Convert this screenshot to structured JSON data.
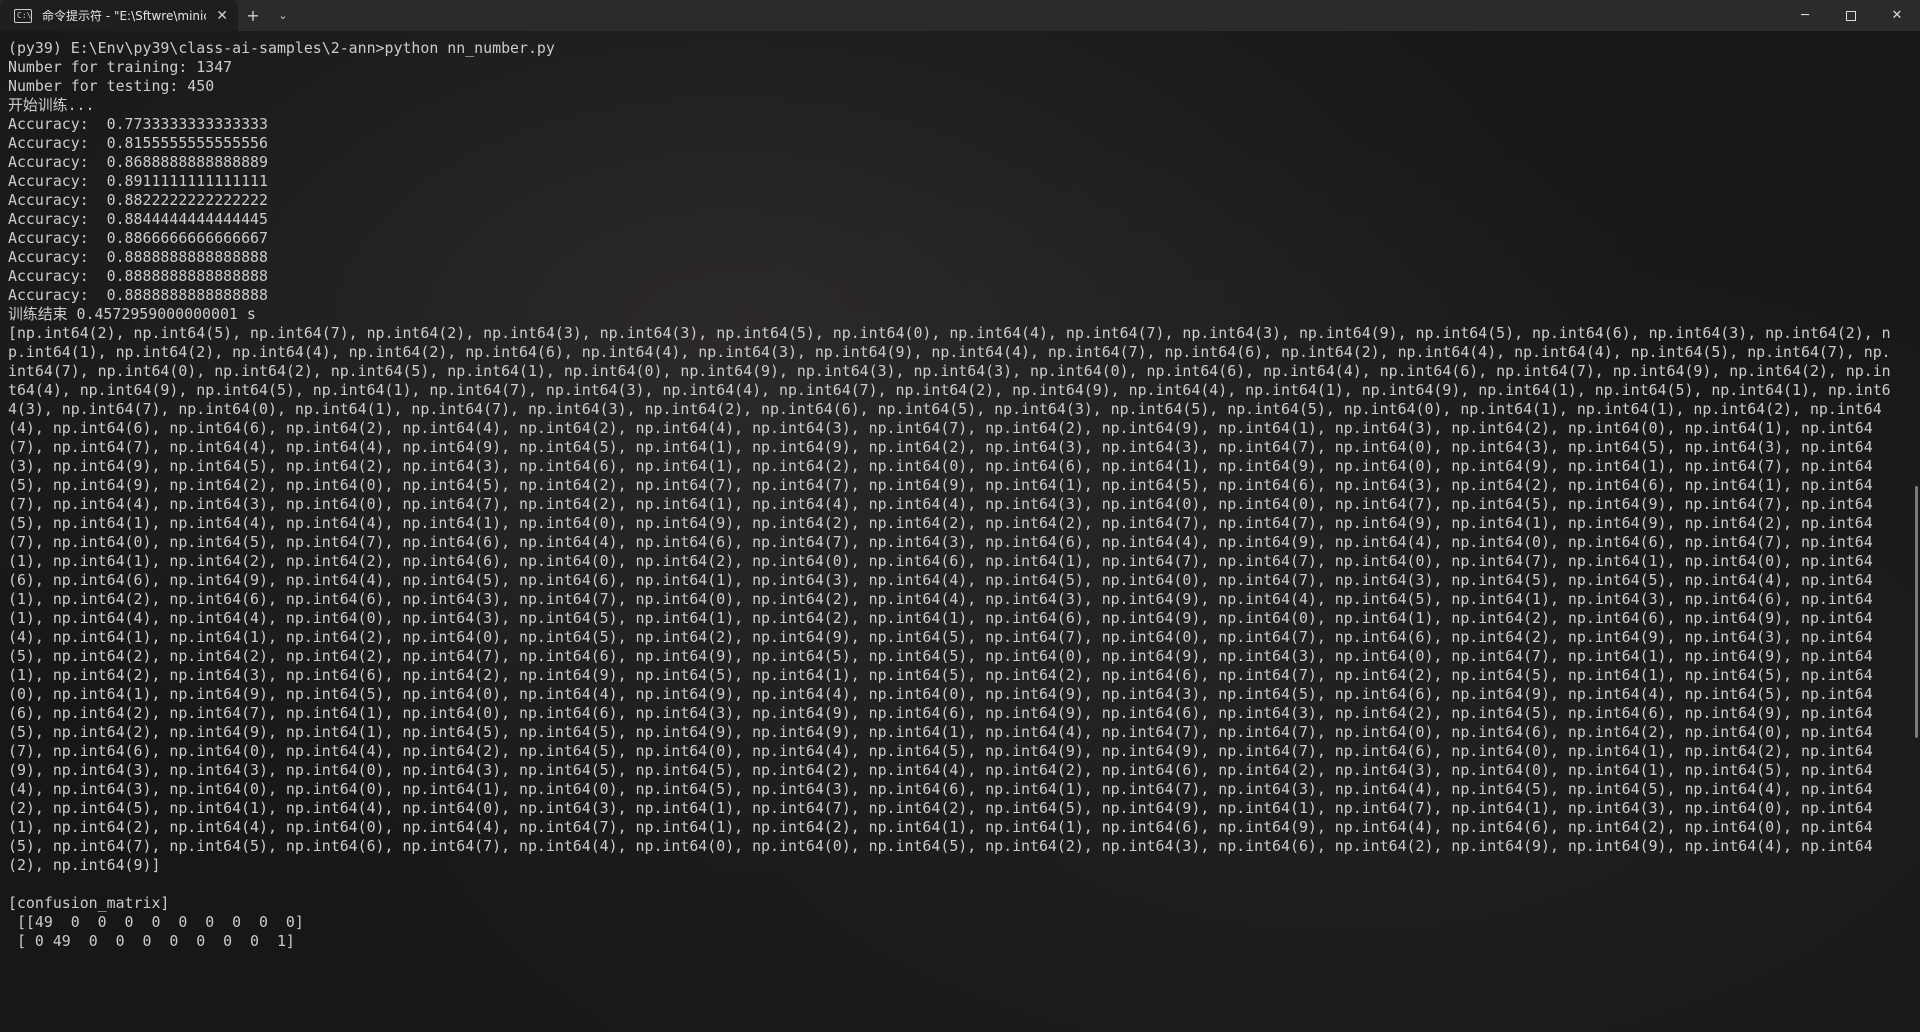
{
  "tab": {
    "icon_text": "C:\\",
    "title": "命令提示符 - \"E:\\Sftwre\\minic"
  },
  "titlebar": {
    "close_tab": "✕",
    "new_tab": "+",
    "dropdown": "⌄",
    "minimize": "─",
    "close": "✕"
  },
  "terminal": {
    "lines": [
      "(py39) E:\\Env\\py39\\class-ai-samples\\2-ann>python nn_number.py",
      "Number for training: 1347",
      "Number for testing: 450",
      "开始训练...",
      "Accuracy:  0.7733333333333333",
      "Accuracy:  0.8155555555555556",
      "Accuracy:  0.8688888888888889",
      "Accuracy:  0.8911111111111111",
      "Accuracy:  0.8822222222222222",
      "Accuracy:  0.8844444444444445",
      "Accuracy:  0.8866666666666667",
      "Accuracy:  0.8888888888888888",
      "Accuracy:  0.8888888888888888",
      "Accuracy:  0.8888888888888888",
      "训练结束 0.4572959000000001 s",
      "[np.int64(2), np.int64(5), np.int64(7), np.int64(2), np.int64(3), np.int64(3), np.int64(5), np.int64(0), np.int64(4), np.int64(7), np.int64(3), np.int64(9), np.int64(5), np.int64(6), np.int64(3), np.int64(2), np.int64(1), np.int64(2), np.int64(4), np.int64(2), np.int64(6), np.int64(4), np.int64(3), np.int64(9), np.int64(4), np.int64(7), np.int64(6), np.int64(2), np.int64(4), np.int64(4), np.int64(5), np.int64(7), np.int64(7), np.int64(0), np.int64(2), np.int64(5), np.int64(1), np.int64(0), np.int64(9), np.int64(3), np.int64(3), np.int64(0), np.int64(6), np.int64(4), np.int64(6), np.int64(7), np.int64(9), np.int64(2), np.int64(4), np.int64(9), np.int64(5), np.int64(1), np.int64(7), np.int64(3), np.int64(4), np.int64(7), np.int64(2), np.int64(9), np.int64(4), np.int64(1), np.int64(9), np.int64(1), np.int64(5), np.int64(1), np.int64(3), np.int64(7), np.int64(0), np.int64(1), np.int64(7), np.int64(3), np.int64(2), np.int64(6), np.int64(5), np.int64(3), np.int64(5), np.int64(5), np.int64(0), np.int64(1), np.int64(1), np.int64(2), np.int64(4), np.int64(6), np.int64(6), np.int64(2), np.int64(4), np.int64(2), np.int64(4), np.int64(3), np.int64(7), np.int64(2), np.int64(9), np.int64(1), np.int64(3), np.int64(2), np.int64(0), np.int64(1), np.int64(7), np.int64(7), np.int64(4), np.int64(4), np.int64(9), np.int64(5), np.int64(1), np.int64(9), np.int64(2), np.int64(3), np.int64(3), np.int64(7), np.int64(0), np.int64(3), np.int64(5), np.int64(3), np.int64(3), np.int64(9), np.int64(5), np.int64(2), np.int64(3), np.int64(6), np.int64(1), np.int64(2), np.int64(0), np.int64(6), np.int64(1), np.int64(9), np.int64(0), np.int64(9), np.int64(1), np.int64(7), np.int64(5), np.int64(9), np.int64(2), np.int64(0), np.int64(5), np.int64(2), np.int64(7), np.int64(7), np.int64(9), np.int64(1), np.int64(5), np.int64(6), np.int64(3), np.int64(2), np.int64(6), np.int64(1), np.int64(7), np.int64(4), np.int64(3), np.int64(0), np.int64(7), np.int64(2), np.int64(1), np.int64(4), np.int64(4), np.int64(3), np.int64(0), np.int64(0), np.int64(7), np.int64(5), np.int64(9), np.int64(7), np.int64(5), np.int64(1), np.int64(4), np.int64(4), np.int64(1), np.int64(0), np.int64(9), np.int64(2), np.int64(2), np.int64(2), np.int64(7), np.int64(7), np.int64(9), np.int64(1), np.int64(9), np.int64(2), np.int64(7), np.int64(0), np.int64(5), np.int64(7), np.int64(6), np.int64(4), np.int64(6), np.int64(7), np.int64(3), np.int64(6), np.int64(4), np.int64(9), np.int64(4), np.int64(0), np.int64(6), np.int64(7), np.int64(1), np.int64(1), np.int64(2), np.int64(2), np.int64(6), np.int64(0), np.int64(2), np.int64(0), np.int64(6), np.int64(1), np.int64(7), np.int64(7), np.int64(0), np.int64(7), np.int64(1), np.int64(0), np.int64(6), np.int64(6), np.int64(9), np.int64(4), np.int64(5), np.int64(6), np.int64(1), np.int64(3), np.int64(4), np.int64(5), np.int64(0), np.int64(7), np.int64(3), np.int64(5), np.int64(5), np.int64(4), np.int64(1), np.int64(2), np.int64(6), np.int64(6), np.int64(3), np.int64(7), np.int64(0), np.int64(2), np.int64(4), np.int64(3), np.int64(9), np.int64(4), np.int64(5), np.int64(1), np.int64(3), np.int64(6), np.int64(1), np.int64(4), np.int64(4), np.int64(0), np.int64(3), np.int64(5), np.int64(1), np.int64(2), np.int64(1), np.int64(6), np.int64(9), np.int64(0), np.int64(1), np.int64(2), np.int64(6), np.int64(9), np.int64(4), np.int64(1), np.int64(1), np.int64(2), np.int64(0), np.int64(5), np.int64(2), np.int64(9), np.int64(5), np.int64(7), np.int64(0), np.int64(7), np.int64(6), np.int64(2), np.int64(9), np.int64(3), np.int64(5), np.int64(2), np.int64(2), np.int64(2), np.int64(7), np.int64(6), np.int64(9), np.int64(5), np.int64(5), np.int64(0), np.int64(9), np.int64(3), np.int64(0), np.int64(7), np.int64(1), np.int64(9), np.int64(1), np.int64(2), np.int64(3), np.int64(6), np.int64(2), np.int64(9), np.int64(5), np.int64(1), np.int64(5), np.int64(2), np.int64(6), np.int64(7), np.int64(2), np.int64(5), np.int64(1), np.int64(5), np.int64(0), np.int64(1), np.int64(9), np.int64(5), np.int64(0), np.int64(4), np.int64(9), np.int64(4), np.int64(0), np.int64(9), np.int64(3), np.int64(5), np.int64(6), np.int64(9), np.int64(4), np.int64(5), np.int64(6), np.int64(2), np.int64(7), np.int64(1), np.int64(0), np.int64(6), np.int64(3), np.int64(9), np.int64(6), np.int64(9), np.int64(6), np.int64(3), np.int64(2), np.int64(5), np.int64(6), np.int64(9), np.int64(5), np.int64(2), np.int64(9), np.int64(1), np.int64(5), np.int64(5), np.int64(9), np.int64(9), np.int64(1), np.int64(4), np.int64(7), np.int64(7), np.int64(0), np.int64(6), np.int64(2), np.int64(0), np.int64(7), np.int64(6), np.int64(0), np.int64(4), np.int64(2), np.int64(5), np.int64(0), np.int64(4), np.int64(5), np.int64(9), np.int64(9), np.int64(7), np.int64(6), np.int64(0), np.int64(1), np.int64(2), np.int64(9), np.int64(3), np.int64(3), np.int64(0), np.int64(3), np.int64(5), np.int64(5), np.int64(2), np.int64(4), np.int64(2), np.int64(6), np.int64(2), np.int64(3), np.int64(0), np.int64(1), np.int64(5), np.int64(4), np.int64(3), np.int64(0), np.int64(0), np.int64(1), np.int64(0), np.int64(5), np.int64(3), np.int64(6), np.int64(1), np.int64(7), np.int64(3), np.int64(4), np.int64(5), np.int64(5), np.int64(4), np.int64(2), np.int64(5), np.int64(1), np.int64(4), np.int64(0), np.int64(3), np.int64(1), np.int64(7), np.int64(2), np.int64(5), np.int64(9), np.int64(1), np.int64(7), np.int64(1), np.int64(3), np.int64(0), np.int64(1), np.int64(2), np.int64(4), np.int64(0), np.int64(4), np.int64(7), np.int64(1), np.int64(2), np.int64(1), np.int64(1), np.int64(6), np.int64(9), np.int64(4), np.int64(6), np.int64(2), np.int64(0), np.int64(5), np.int64(7), np.int64(5), np.int64(6), np.int64(7), np.int64(4), np.int64(0), np.int64(0), np.int64(5), np.int64(2), np.int64(3), np.int64(6), np.int64(2), np.int64(9), np.int64(9), np.int64(4), np.int64(2), np.int64(9)]",
      "",
      "[confusion_matrix]",
      " [[49  0  0  0  0  0  0  0  0  0]",
      " [ 0 49  0  0  0  0  0  0  0  1]"
    ]
  }
}
